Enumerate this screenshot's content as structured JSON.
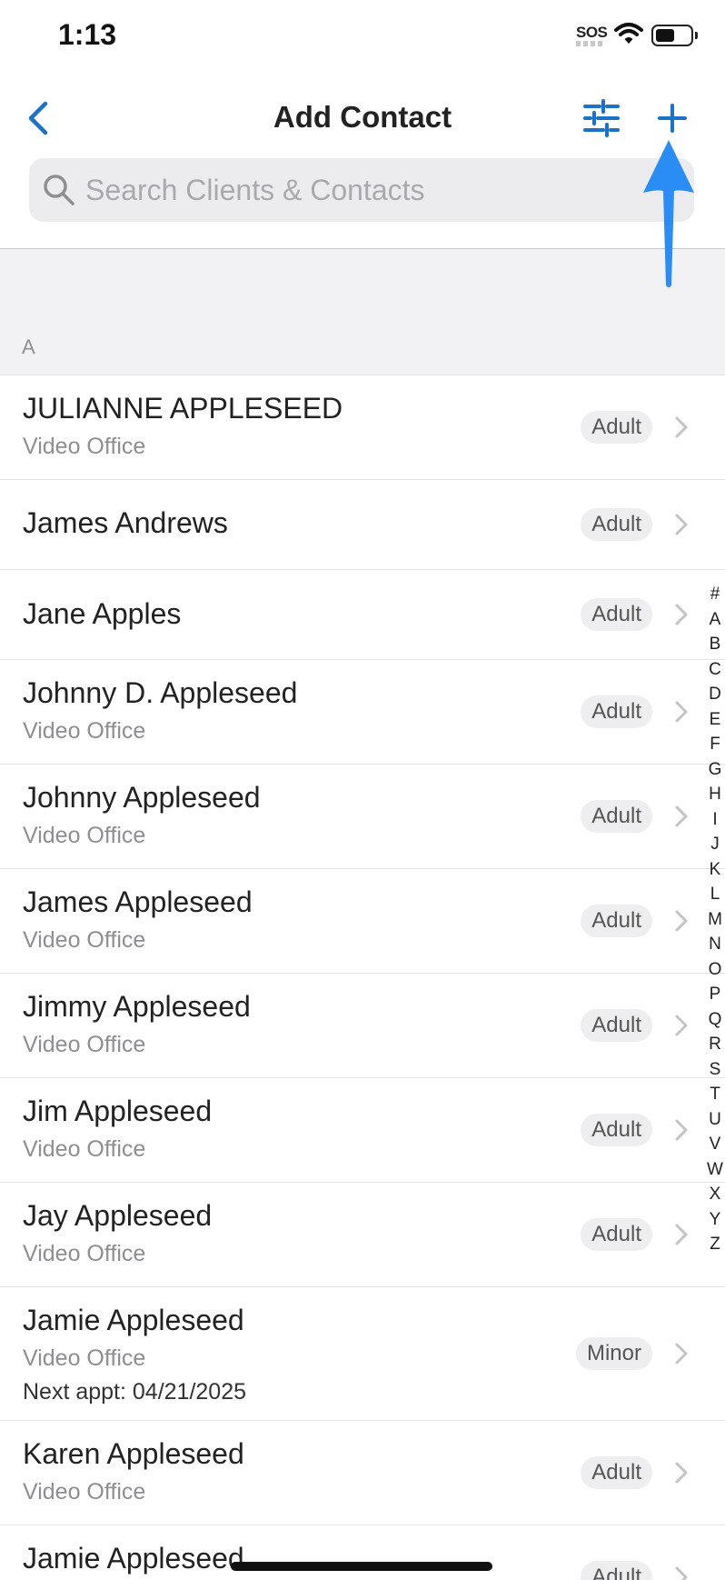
{
  "status_bar": {
    "time": "1:13",
    "sos": "SOS"
  },
  "nav": {
    "title": "Add Contact",
    "back_icon": "chevron-left-icon",
    "filter_icon": "sliders-icon",
    "add_icon": "plus-icon",
    "accent_color": "#1a73c9"
  },
  "search": {
    "placeholder": "Search Clients & Contacts",
    "value": ""
  },
  "section": {
    "letter": "A"
  },
  "contacts": [
    {
      "name": "JULIANNE APPLESEED",
      "sub": "Video Office",
      "appt": "",
      "badge": "Adult"
    },
    {
      "name": "James Andrews",
      "sub": "",
      "appt": "",
      "badge": "Adult"
    },
    {
      "name": "Jane Apples",
      "sub": "",
      "appt": "",
      "badge": "Adult"
    },
    {
      "name": "Johnny D. Appleseed",
      "sub": "Video Office",
      "appt": "",
      "badge": "Adult"
    },
    {
      "name": "Johnny Appleseed",
      "sub": "Video Office",
      "appt": "",
      "badge": "Adult"
    },
    {
      "name": "James Appleseed",
      "sub": "Video Office",
      "appt": "",
      "badge": "Adult"
    },
    {
      "name": "Jimmy Appleseed",
      "sub": "Video Office",
      "appt": "",
      "badge": "Adult"
    },
    {
      "name": "Jim Appleseed",
      "sub": "Video Office",
      "appt": "",
      "badge": "Adult"
    },
    {
      "name": "Jay Appleseed",
      "sub": "Video Office",
      "appt": "",
      "badge": "Adult"
    },
    {
      "name": "Jamie Appleseed",
      "sub": "Video Office",
      "appt": "Next appt: 04/21/2025",
      "badge": "Minor"
    },
    {
      "name": "Karen Appleseed",
      "sub": "Video Office",
      "appt": "",
      "badge": "Adult"
    },
    {
      "name": "Jamie Appleseed",
      "sub": "",
      "appt": "",
      "badge": "Adult"
    }
  ],
  "index_letters": [
    "#",
    "A",
    "B",
    "C",
    "D",
    "E",
    "F",
    "G",
    "H",
    "I",
    "J",
    "K",
    "L",
    "M",
    "N",
    "O",
    "P",
    "Q",
    "R",
    "S",
    "T",
    "U",
    "V",
    "W",
    "X",
    "Y",
    "Z"
  ],
  "annotation": {
    "icon": "arrow-up-icon",
    "color": "#2a8cf5"
  }
}
